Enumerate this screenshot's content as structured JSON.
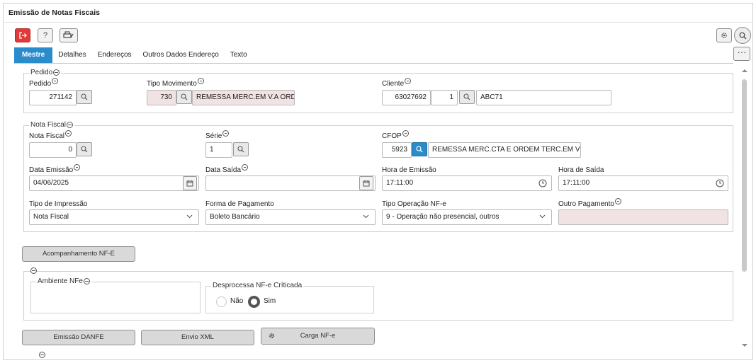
{
  "window": {
    "title": "Emissão de Notas Fiscais"
  },
  "toolbar": {
    "exit_icon": "exit-icon",
    "help_glyph": "?",
    "print_icon": "print-icon",
    "settings_icon": "gear-icon",
    "search_icon": "search-icon"
  },
  "tabs": [
    {
      "label": "Mestre",
      "active": true
    },
    {
      "label": "Detalhes"
    },
    {
      "label": "Endereços"
    },
    {
      "label": "Outros Dados Endereço"
    },
    {
      "label": "Texto"
    }
  ],
  "more_glyph": "···",
  "pedido": {
    "group_label": "Pedido",
    "pedido_label": "Pedido",
    "pedido_value": "271142",
    "tipo_mov_label": "Tipo Movimento",
    "tipo_mov_code": "730",
    "tipo_mov_desc": "REMESSA MERC.EM V.A ORDEM",
    "cliente_label": "Cliente",
    "cliente_code": "63027692",
    "cliente_seq": "1",
    "cliente_name": "ABC71"
  },
  "nota": {
    "group_label": "Nota Fiscal",
    "nota_label": "Nota Fiscal",
    "nota_value": "0",
    "serie_label": "Série",
    "serie_value": "1",
    "cfop_label": "CFOP",
    "cfop_code": "5923",
    "cfop_desc": "REMESSA MERC.CTA E ORDEM TERC.EM V ORDE",
    "data_emissao_label": "Data Emissão",
    "data_emissao_value": "04/06/2025",
    "data_saida_label": "Data Saída",
    "data_saida_value": "",
    "hora_emissao_label": "Hora de Emissão",
    "hora_emissao_value": "17:11:00",
    "hora_saida_label": "Hora de Saída",
    "hora_saida_value": "17:11:00",
    "tipo_impressao_label": "Tipo de Impressão",
    "tipo_impressao_value": "Nota Fiscal",
    "forma_pag_label": "Forma de Pagamento",
    "forma_pag_value": "Boleto Bancário",
    "tipo_op_label": "Tipo Operação NF-e",
    "tipo_op_value": "9 - Operação não presencial, outros",
    "outro_pag_label": "Outro Pagamento",
    "outro_pag_value": ""
  },
  "acompanhamento_label": "Acompanhamento NF-E",
  "ambiente": {
    "group_label": "Ambiente NFe",
    "desprocessa_label": "Desprocessa NF-e Críticada",
    "nao_label": "Não",
    "sim_label": "Sim",
    "selected": "Sim"
  },
  "actions": {
    "emissao_danfe": "Emissão DANFE",
    "envio_xml": "Envio XML",
    "carga_nfe": "Carga NF-e"
  }
}
